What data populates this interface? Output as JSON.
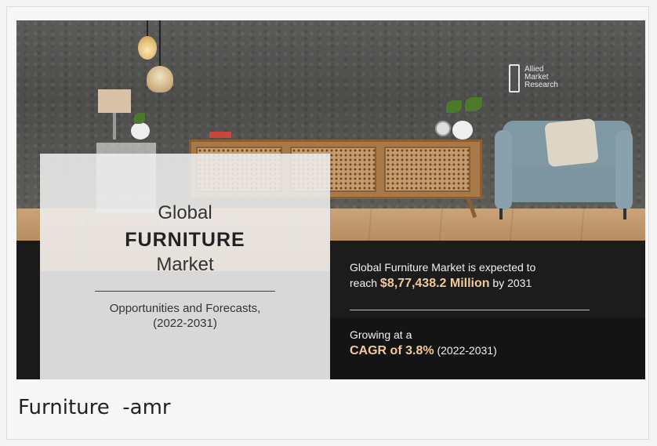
{
  "banner": {
    "brand": {
      "icon": "allied-market-research-logo",
      "line1": "Allied",
      "line2": "Market",
      "line3": "Research"
    },
    "panel": {
      "title_line1": "Global",
      "title_line2": "FURNITURE",
      "title_line3": "Market",
      "subtitle_line1": "Opportunities and Forecasts,",
      "subtitle_line2": "(2022-2031)"
    },
    "stat1": {
      "text_line1": "Global Furniture Market is expected to",
      "prefix": "reach ",
      "value": "$8,77,438.2 Million",
      "suffix": " by 2031"
    },
    "stat2": {
      "text_line1": "Growing at a",
      "value": "CAGR of 3.8%",
      "suffix": " (2022-2031)"
    }
  },
  "caption": "Furniture  -amr",
  "colors": {
    "highlight": "#f3c99b",
    "dark_panel": "#1c1c1c",
    "light_panel": "#eeeeee"
  }
}
